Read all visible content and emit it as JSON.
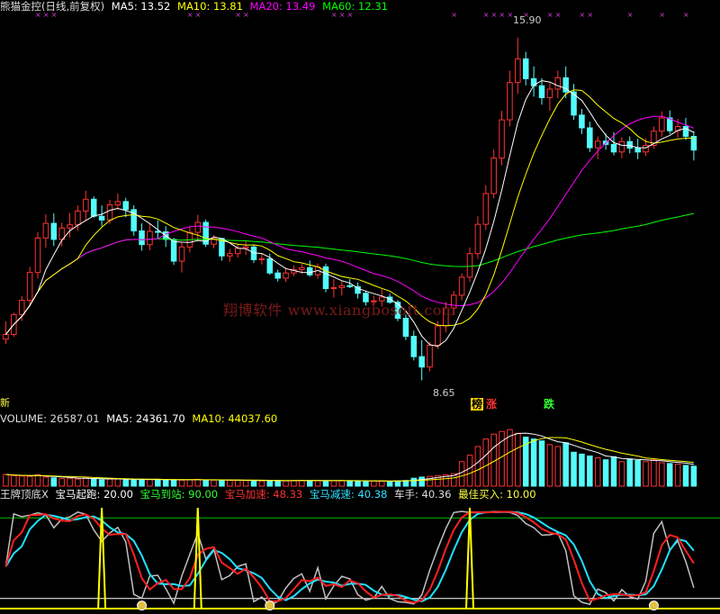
{
  "main_legend": {
    "title": "熊猫金控(日线,前复权)",
    "ma5": "MA5: 13.52",
    "ma10": "MA10: 13.81",
    "ma20": "MA20: 13.49",
    "ma60": "MA60: 12.31"
  },
  "price_high_label": "15.90",
  "price_low_label": "8.65",
  "watermark": "翔博软件 www.xiangbosoft.com",
  "left_edge_char": "新",
  "tags": {
    "bang": "榜",
    "zhang": "涨",
    "die": "跌"
  },
  "volume_legend": {
    "volume": "VOLUME: 26587.01",
    "ma5": "MA5: 24361.70",
    "ma10": "MA10: 44037.60"
  },
  "indicator_legend": {
    "name": "王牌顶底X",
    "qidong": "宝马起跑: 20.00",
    "daozhan": "宝马到站: 90.00",
    "jiasu": "宝马加速: 48.33",
    "jiansu": "宝马减速: 40.38",
    "chezhu": "车手: 40.36",
    "buy": "最佳买入: 10.00"
  },
  "colors": {
    "up": "#ff3232",
    "down": "#54fcfc",
    "ma5": "#ffffff",
    "ma10": "#ffff00",
    "ma20": "#ff00ff",
    "ma60": "#00ff00",
    "speed_red": "#ff2020",
    "speed_cyan": "#20e0ff",
    "driver_grey": "#c0c0c0"
  },
  "chart_data": {
    "type": "candlestick",
    "price_range": [
      8.65,
      15.9
    ],
    "candles": [
      [
        9.52,
        9.9,
        9.42,
        9.62
      ],
      [
        9.62,
        10.08,
        9.57,
        10.04
      ],
      [
        10.04,
        10.43,
        9.9,
        10.34
      ],
      [
        10.34,
        11.05,
        10.2,
        10.93
      ],
      [
        10.93,
        11.78,
        10.8,
        11.66
      ],
      [
        11.66,
        12.16,
        11.46,
        11.97
      ],
      [
        11.97,
        12.18,
        11.49,
        11.63
      ],
      [
        11.63,
        11.98,
        11.48,
        11.87
      ],
      [
        11.87,
        12.19,
        11.67,
        11.94
      ],
      [
        11.94,
        12.35,
        11.81,
        12.23
      ],
      [
        12.23,
        12.66,
        12.04,
        12.48
      ],
      [
        12.48,
        12.54,
        12.09,
        12.12
      ],
      [
        12.12,
        12.35,
        11.91,
        12.04
      ],
      [
        12.04,
        12.47,
        11.96,
        12.36
      ],
      [
        12.36,
        12.6,
        12.26,
        12.43
      ],
      [
        12.43,
        12.51,
        12.1,
        12.26
      ],
      [
        12.26,
        12.35,
        11.71,
        11.81
      ],
      [
        11.81,
        11.97,
        11.39,
        11.52
      ],
      [
        11.52,
        11.96,
        11.4,
        11.8
      ],
      [
        11.8,
        12.03,
        11.65,
        11.79
      ],
      [
        11.79,
        11.91,
        11.47,
        11.63
      ],
      [
        11.63,
        11.66,
        11.09,
        11.17
      ],
      [
        11.17,
        11.56,
        10.93,
        11.47
      ],
      [
        11.47,
        11.9,
        11.35,
        11.78
      ],
      [
        11.78,
        12.15,
        11.59,
        11.99
      ],
      [
        11.99,
        12.05,
        11.47,
        11.53
      ],
      [
        11.53,
        11.72,
        11.44,
        11.65
      ],
      [
        11.65,
        11.66,
        11.18,
        11.28
      ],
      [
        11.28,
        11.43,
        11.16,
        11.33
      ],
      [
        11.33,
        11.53,
        11.24,
        11.44
      ],
      [
        11.44,
        11.6,
        11.3,
        11.47
      ],
      [
        11.47,
        11.52,
        11.13,
        11.2
      ],
      [
        11.2,
        11.34,
        11.1,
        11.22
      ],
      [
        11.22,
        11.33,
        10.88,
        10.92
      ],
      [
        10.92,
        10.99,
        10.74,
        10.81
      ],
      [
        10.81,
        11.03,
        10.73,
        10.92
      ],
      [
        10.92,
        11.08,
        10.85,
        10.99
      ],
      [
        10.99,
        11.11,
        10.9,
        11.03
      ],
      [
        11.03,
        11.18,
        10.84,
        10.88
      ],
      [
        10.88,
        11.12,
        10.8,
        11.05
      ],
      [
        11.05,
        11.12,
        10.51,
        10.59
      ],
      [
        10.59,
        10.79,
        10.4,
        10.61
      ],
      [
        10.61,
        10.76,
        10.44,
        10.65
      ],
      [
        10.65,
        10.79,
        10.6,
        10.63
      ],
      [
        10.63,
        10.72,
        10.38,
        10.49
      ],
      [
        10.49,
        10.53,
        10.23,
        10.31
      ],
      [
        10.31,
        10.44,
        10.24,
        10.33
      ],
      [
        10.33,
        10.58,
        10.21,
        10.41
      ],
      [
        10.41,
        10.48,
        10.27,
        10.3
      ],
      [
        10.3,
        10.35,
        9.9,
        9.96
      ],
      [
        9.96,
        10.04,
        9.5,
        9.58
      ],
      [
        9.58,
        9.7,
        9.07,
        9.15
      ],
      [
        9.15,
        9.5,
        8.65,
        8.93
      ],
      [
        8.93,
        9.46,
        8.84,
        9.39
      ],
      [
        9.39,
        9.9,
        9.31,
        9.8
      ],
      [
        9.8,
        10.31,
        9.66,
        10.18
      ],
      [
        10.18,
        10.54,
        10.04,
        10.45
      ],
      [
        10.45,
        10.91,
        10.34,
        10.83
      ],
      [
        10.83,
        11.46,
        10.73,
        11.33
      ],
      [
        11.33,
        12.12,
        11.22,
        11.95
      ],
      [
        11.95,
        12.78,
        11.83,
        12.6
      ],
      [
        12.6,
        13.53,
        12.5,
        13.35
      ],
      [
        13.35,
        14.35,
        13.2,
        14.16
      ],
      [
        14.16,
        15.2,
        14.02,
        14.95
      ],
      [
        14.95,
        15.9,
        14.71,
        15.45
      ],
      [
        15.45,
        15.6,
        14.89,
        15.03
      ],
      [
        15.03,
        15.29,
        14.65,
        14.88
      ],
      [
        14.88,
        15.04,
        14.48,
        14.63
      ],
      [
        14.63,
        14.96,
        14.35,
        14.81
      ],
      [
        14.81,
        15.2,
        14.62,
        15.05
      ],
      [
        15.05,
        15.29,
        14.62,
        14.75
      ],
      [
        14.75,
        14.92,
        14.16,
        14.26
      ],
      [
        14.26,
        14.39,
        13.86,
        13.99
      ],
      [
        13.99,
        14.12,
        13.48,
        13.57
      ],
      [
        13.57,
        13.81,
        13.33,
        13.71
      ],
      [
        13.71,
        13.87,
        13.53,
        13.64
      ],
      [
        13.64,
        13.9,
        13.41,
        13.48
      ],
      [
        13.48,
        13.79,
        13.35,
        13.7
      ],
      [
        13.7,
        13.81,
        13.45,
        13.56
      ],
      [
        13.56,
        13.76,
        13.33,
        13.48
      ],
      [
        13.48,
        13.77,
        13.4,
        13.62
      ],
      [
        13.62,
        14.02,
        13.55,
        13.92
      ],
      [
        13.92,
        14.34,
        13.8,
        14.2
      ],
      [
        14.2,
        14.36,
        13.86,
        13.93
      ],
      [
        13.93,
        14.18,
        13.78,
        14.02
      ],
      [
        14.02,
        14.2,
        13.73,
        13.81
      ],
      [
        13.81,
        13.92,
        13.3,
        13.52
      ]
    ],
    "volume": [
      3100,
      2800,
      2700,
      2600,
      3000,
      2400,
      2200,
      2000,
      2100,
      1900,
      2300,
      1800,
      1700,
      1900,
      2000,
      1800,
      1700,
      1600,
      1750,
      1800,
      1700,
      1650,
      1600,
      1700,
      1800,
      1650,
      1600,
      1500,
      1550,
      1600,
      1500,
      1450,
      1400,
      1500,
      1450,
      1400,
      1500,
      1550,
      1450,
      1500,
      1400,
      1450,
      1500,
      1400,
      1350,
      1300,
      1400,
      1350,
      1300,
      1400,
      1500,
      2100,
      2400,
      2600,
      2800,
      3000,
      3300,
      6500,
      8200,
      10500,
      12500,
      13800,
      14500,
      15000,
      14000,
      13000,
      12500,
      12000,
      11000,
      10500,
      11500,
      9000,
      8500,
      8000,
      7500,
      7000,
      7800,
      6500,
      7200,
      6800,
      6500,
      7000,
      6200,
      6000,
      5800,
      5500,
      5300
    ],
    "indicator": {
      "qidong": 20.0,
      "daozhan": 90.0,
      "jiasu": 48.33,
      "jiansu": 40.38,
      "chezhu": 40.36,
      "buy": 10.0
    }
  }
}
